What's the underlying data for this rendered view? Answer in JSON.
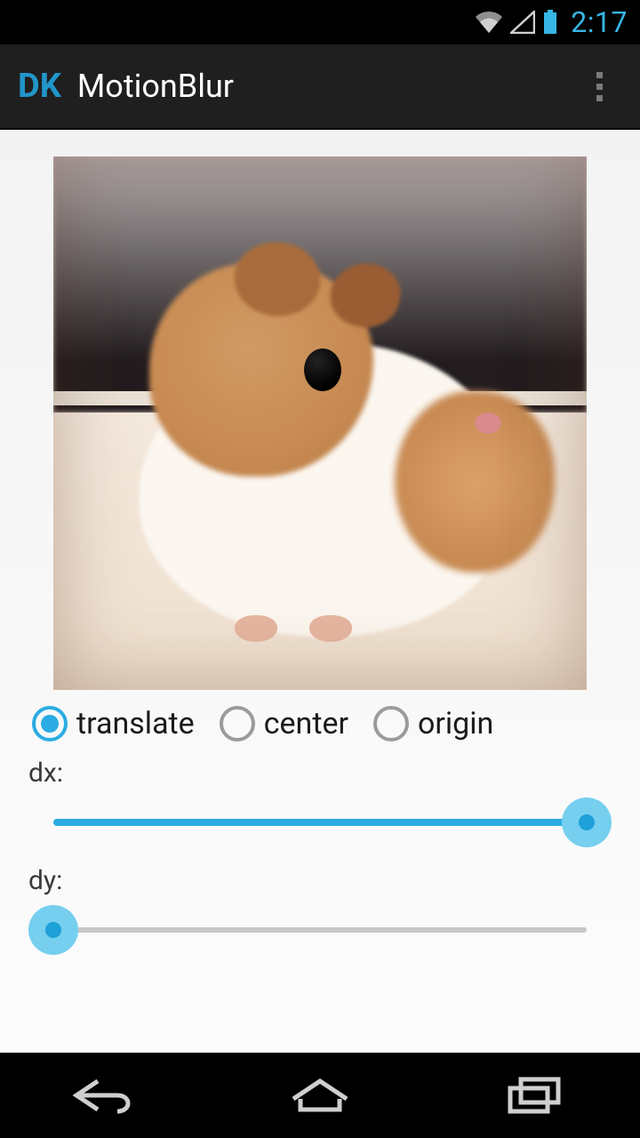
{
  "status": {
    "time": "2:17"
  },
  "actionbar": {
    "logo": "DK",
    "title": "MotionBlur"
  },
  "radios": {
    "items": [
      {
        "label": "translate",
        "selected": true
      },
      {
        "label": "center",
        "selected": false
      },
      {
        "label": "origin",
        "selected": false
      }
    ]
  },
  "sliders": {
    "dx": {
      "label": "dx:",
      "percent": 100
    },
    "dy": {
      "label": "dy:",
      "percent": 0
    }
  },
  "colors": {
    "accent": "#2bace3"
  }
}
